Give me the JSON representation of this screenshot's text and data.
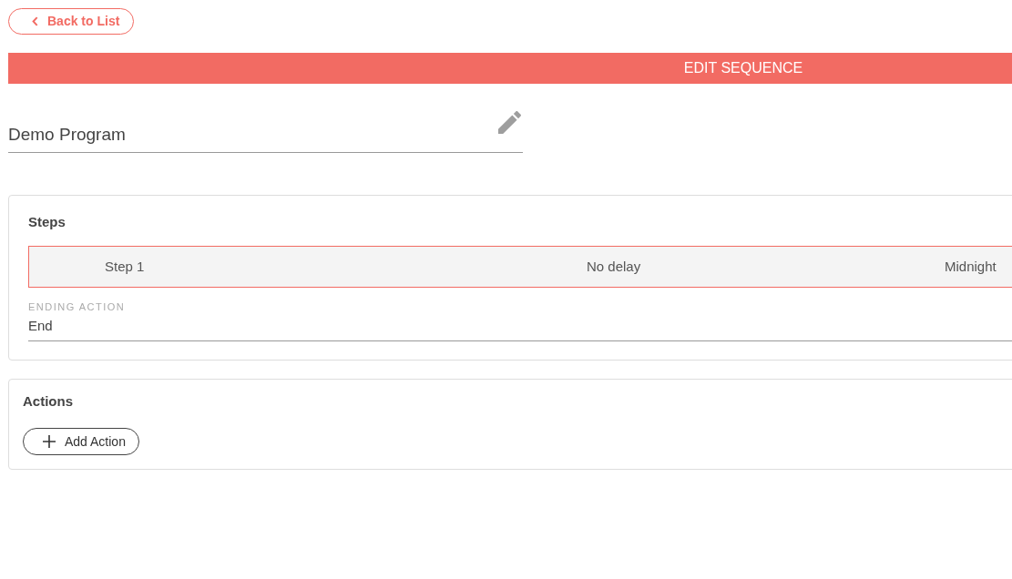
{
  "back_button": {
    "label": "Back to List"
  },
  "header": {
    "title": "EDIT SEQUENCE"
  },
  "name_field": {
    "value": "Demo Program"
  },
  "steps_panel": {
    "title": "Steps",
    "steps": [
      {
        "name": "Step 1",
        "delay": "No delay",
        "time": "Midnight",
        "selected": true
      }
    ],
    "ending_action": {
      "label": "ENDING ACTION",
      "value": "End"
    }
  },
  "actions_panel": {
    "title": "Actions",
    "add_button": {
      "label": "Add Action"
    }
  }
}
